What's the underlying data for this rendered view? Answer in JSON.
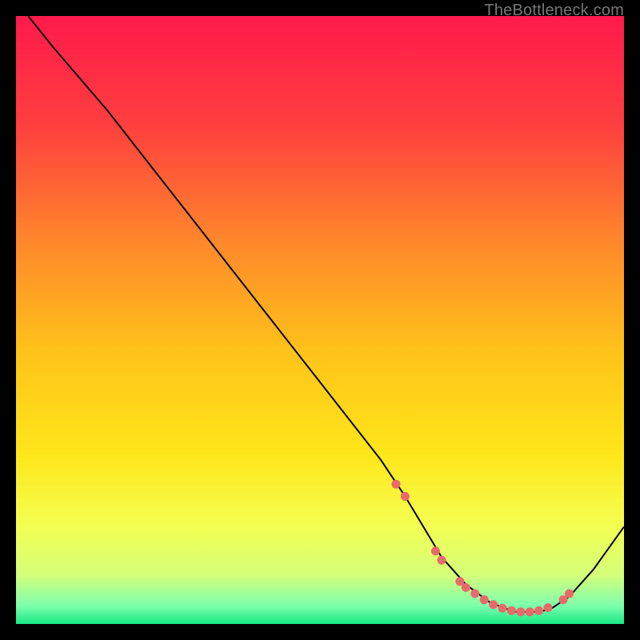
{
  "watermark": "TheBottleneck.com",
  "chart_data": {
    "type": "line",
    "title": "",
    "xlabel": "",
    "ylabel": "",
    "xlim": [
      0,
      100
    ],
    "ylim": [
      0,
      100
    ],
    "gradient_stops": [
      {
        "pct": 0,
        "color": "#ff1a4b"
      },
      {
        "pct": 18,
        "color": "#ff3f3f"
      },
      {
        "pct": 38,
        "color": "#ff8a2a"
      },
      {
        "pct": 55,
        "color": "#ffc21a"
      },
      {
        "pct": 72,
        "color": "#ffe61a"
      },
      {
        "pct": 84,
        "color": "#f4ff52"
      },
      {
        "pct": 92,
        "color": "#d4ff7a"
      },
      {
        "pct": 97,
        "color": "#7dffad"
      },
      {
        "pct": 100,
        "color": "#17e884"
      }
    ],
    "series": [
      {
        "name": "curve",
        "color": "#000000",
        "x": [
          2,
          6,
          15,
          24,
          33,
          42,
          51,
          60,
          64,
          67,
          70,
          74,
          78,
          82,
          86,
          88,
          91,
          95,
          100
        ],
        "y": [
          100,
          95,
          84.5,
          73,
          61.5,
          50,
          38.5,
          27,
          21,
          16,
          11,
          6.5,
          3.5,
          2,
          2,
          2.5,
          4.5,
          9,
          16
        ]
      }
    ],
    "markers": {
      "name": "dots",
      "color": "#e86a6a",
      "points": [
        {
          "x": 62.5,
          "y": 23
        },
        {
          "x": 64,
          "y": 21
        },
        {
          "x": 69,
          "y": 12
        },
        {
          "x": 70,
          "y": 10.5
        },
        {
          "x": 73,
          "y": 7
        },
        {
          "x": 74,
          "y": 6
        },
        {
          "x": 75.5,
          "y": 5
        },
        {
          "x": 77,
          "y": 4
        },
        {
          "x": 78.5,
          "y": 3.2
        },
        {
          "x": 80,
          "y": 2.6
        },
        {
          "x": 81.5,
          "y": 2.2
        },
        {
          "x": 83,
          "y": 2
        },
        {
          "x": 84.5,
          "y": 2
        },
        {
          "x": 86,
          "y": 2.2
        },
        {
          "x": 87.5,
          "y": 2.7
        },
        {
          "x": 90,
          "y": 4
        },
        {
          "x": 91,
          "y": 5
        }
      ]
    }
  }
}
